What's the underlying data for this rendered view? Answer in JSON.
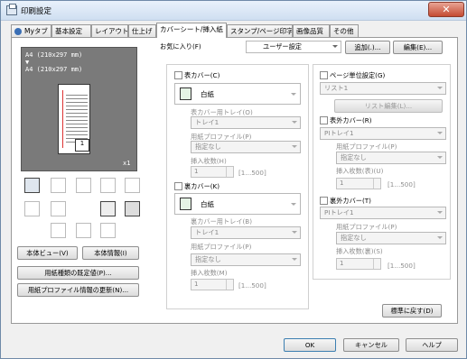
{
  "window": {
    "title": "印刷設定",
    "close_label": "✕"
  },
  "tabs": [
    {
      "label": "Myタブ",
      "active": false
    },
    {
      "label": "基本設定",
      "active": false
    },
    {
      "label": "レイアウト",
      "active": false
    },
    {
      "label": "仕上げ",
      "active": false
    },
    {
      "label": "カバーシート/挿入紙",
      "active": true
    },
    {
      "label": "スタンプ/ページ印字",
      "active": false
    },
    {
      "label": "画像品質",
      "active": false
    },
    {
      "label": "その他",
      "active": false
    }
  ],
  "preview": {
    "line1": "A4 (210x297 mm)",
    "arrow": "▼",
    "line2": "A4 (210x297 mm)",
    "copies": "x1"
  },
  "left_buttons": {
    "view": "本体ビュー(V)",
    "info": "本体情報(I)",
    "paper_default": "用紙種類の既定値(P)...",
    "profile_update": "用紙プロファイル情報の更新(N)..."
  },
  "favorites": {
    "label": "お気に入り(F)",
    "value": "ユーザー設定",
    "add": "追加(.)...",
    "edit": "編集(E)..."
  },
  "front_cover": {
    "label": "表カバー(C)",
    "paper": "白紙",
    "tray_label": "表カバー用トレイ(O)",
    "tray": "トレイ1",
    "profile_label": "用紙プロファイル(P)",
    "profile": "指定なし",
    "count_label": "挿入枚数(H)",
    "count": "1",
    "range": "[1...500]"
  },
  "back_cover": {
    "label": "裏カバー(K)",
    "paper": "白紙",
    "tray_label": "裏カバー用トレイ(B)",
    "tray": "トレイ1",
    "profile_label": "用紙プロファイル(P)",
    "profile": "指定なし",
    "count_label": "挿入枚数(M)",
    "count": "1",
    "range": "[1...500]"
  },
  "page_setting": {
    "label": "ページ単位設定(G)",
    "list": "リスト1",
    "edit": "リスト編集(L)..."
  },
  "front_outer": {
    "label": "表外カバー(R)",
    "tray": "PIトレイ1",
    "profile_label": "用紙プロファイル(P)",
    "profile": "指定なし",
    "count_label": "挿入枚数(表)(U)",
    "count": "1",
    "range": "[1...500]"
  },
  "back_outer": {
    "label": "裏外カバー(T)",
    "tray": "PIトレイ1",
    "profile_label": "用紙プロファイル(P)",
    "profile": "指定なし",
    "count_label": "挿入枚数(裏)(S)",
    "count": "1",
    "range": "[1...500]"
  },
  "restore": "標準に戻す(D)",
  "footer": {
    "ok": "OK",
    "cancel": "キャンセル",
    "help": "ヘルプ"
  }
}
